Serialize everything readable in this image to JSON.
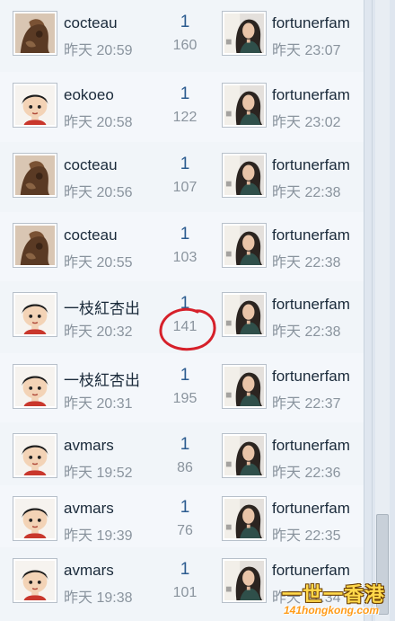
{
  "rows": [
    {
      "author": "cocteau",
      "author_avatar": "photo-avatar-icon",
      "time": "昨天 20:59",
      "replies": "1",
      "views": "160",
      "last_poster": "fortunerfam",
      "last_avatar": "woman-photo-avatar-icon",
      "last_time": "昨天 23:07"
    },
    {
      "author": "eokoeo",
      "author_avatar": "cartoon-boy-avatar-icon",
      "time": "昨天 20:58",
      "replies": "1",
      "views": "122",
      "last_poster": "fortunerfam",
      "last_avatar": "woman-photo-avatar-icon",
      "last_time": "昨天 23:02"
    },
    {
      "author": "cocteau",
      "author_avatar": "photo-avatar-icon",
      "time": "昨天 20:56",
      "replies": "1",
      "views": "107",
      "last_poster": "fortunerfam",
      "last_avatar": "woman-photo-avatar-icon",
      "last_time": "昨天 22:38"
    },
    {
      "author": "cocteau",
      "author_avatar": "photo-avatar-icon",
      "time": "昨天 20:55",
      "replies": "1",
      "views": "103",
      "last_poster": "fortunerfam",
      "last_avatar": "woman-photo-avatar-icon",
      "last_time": "昨天 22:38"
    },
    {
      "author": "一枝紅杏出",
      "author_avatar": "cartoon-boy-avatar-icon",
      "time": "昨天 20:32",
      "replies": "1",
      "views": "141",
      "last_poster": "fortunerfam",
      "last_avatar": "woman-photo-avatar-icon",
      "last_time": "昨天 22:38"
    },
    {
      "author": "一枝紅杏出",
      "author_avatar": "cartoon-boy-avatar-icon",
      "time": "昨天 20:31",
      "replies": "1",
      "views": "195",
      "last_poster": "fortunerfam",
      "last_avatar": "woman-photo-avatar-icon",
      "last_time": "昨天 22:37"
    },
    {
      "author": "avmars",
      "author_avatar": "cartoon-boy-avatar-icon",
      "time": "昨天 19:52",
      "replies": "1",
      "views": "86",
      "last_poster": "fortunerfam",
      "last_avatar": "woman-photo-avatar-icon",
      "last_time": "昨天 22:36"
    },
    {
      "author": "avmars",
      "author_avatar": "cartoon-boy-avatar-icon",
      "time": "昨天 19:39",
      "replies": "1",
      "views": "76",
      "last_poster": "fortunerfam",
      "last_avatar": "woman-photo-avatar-icon",
      "last_time": "昨天 22:35"
    },
    {
      "author": "avmars",
      "author_avatar": "cartoon-boy-avatar-icon",
      "time": "昨天 19:38",
      "replies": "1",
      "views": "101",
      "last_poster": "fortunerfam",
      "last_avatar": "woman-photo-avatar-icon",
      "last_time": "昨天 22:34"
    }
  ],
  "watermark": {
    "main": "一世一香港",
    "sub": "141hongkong.com"
  },
  "colors": {
    "accent": "#2b5b8f",
    "annotation": "#d6202a",
    "muted": "#8a949e"
  }
}
